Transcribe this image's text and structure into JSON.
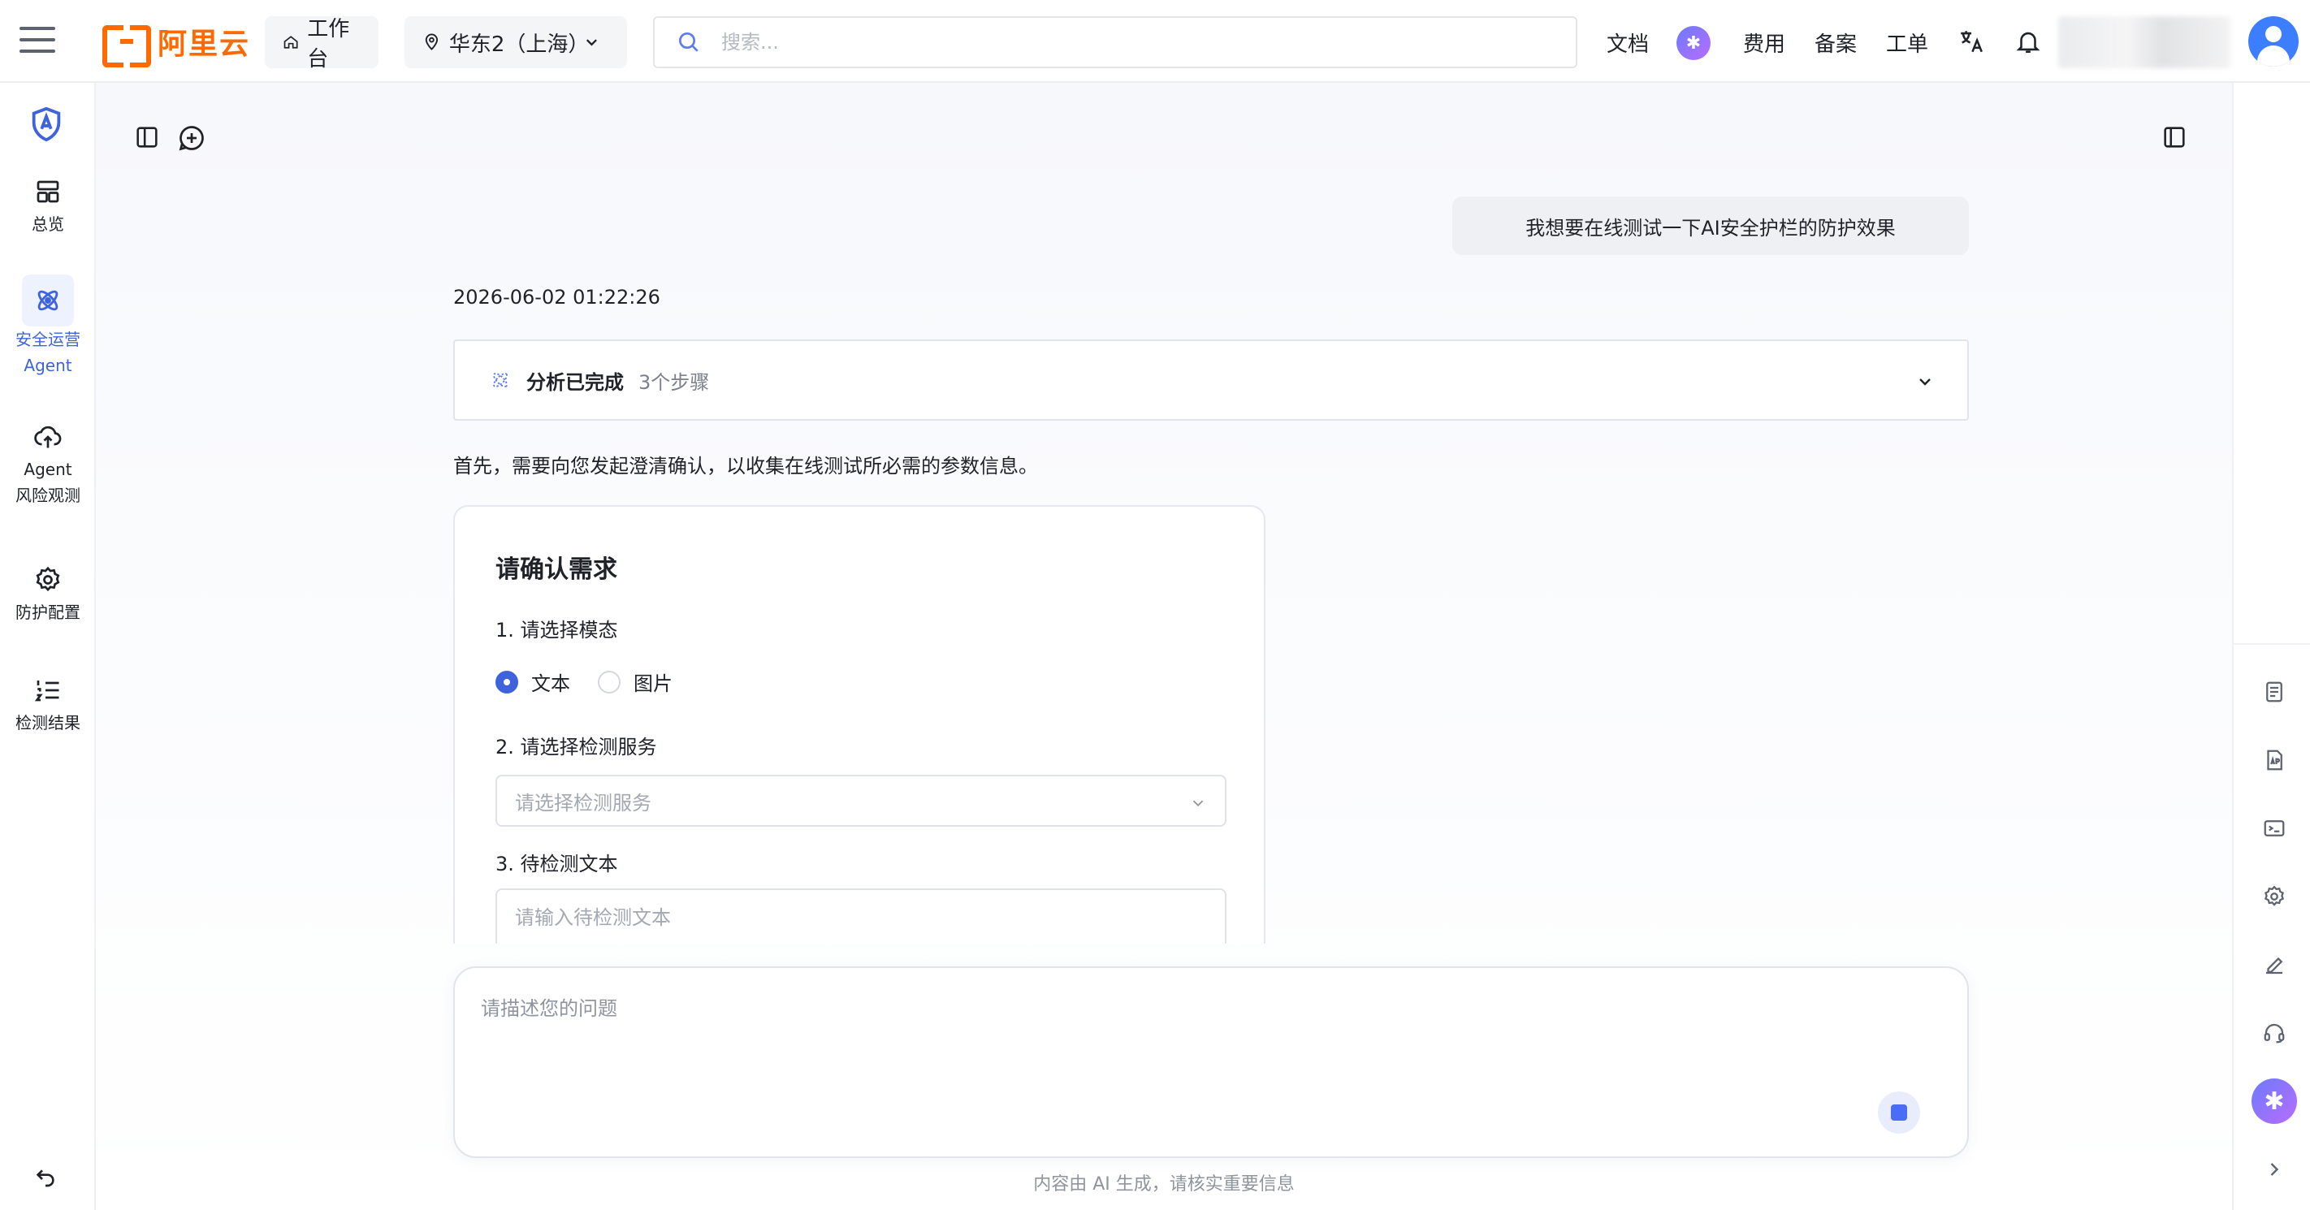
{
  "brand": {
    "logo_text": "阿里云",
    "color": "#ff6a00"
  },
  "topbar": {
    "workbench_label": "工作台",
    "region_label": "华东2（上海）",
    "search_placeholder": "搜索...",
    "links": {
      "docs": "文档",
      "fees": "费用",
      "filing": "备案",
      "ticket": "工单"
    },
    "icons": [
      "menu-icon",
      "home-icon",
      "location-icon",
      "search-icon",
      "ai-assistant-icon",
      "translate-icon",
      "bell-icon",
      "avatar"
    ]
  },
  "sidebar": {
    "items": [
      {
        "label": "总览",
        "icon": "dashboard-icon"
      },
      {
        "label": "安全运营",
        "label2": "Agent",
        "icon": "atom-icon",
        "active": true
      },
      {
        "label": "Agent",
        "label2": "风险观测",
        "icon": "cloud-upload-icon"
      },
      {
        "label": "防护配置",
        "icon": "gear-icon"
      },
      {
        "label": "检测结果",
        "icon": "list-ordered-icon"
      }
    ]
  },
  "chat": {
    "user_message": "我想要在线测试一下AI安全护栏的防护效果",
    "timestamp": "2026-06-02 01:22:26",
    "analysis": {
      "title": "分析已完成",
      "steps": "3个步骤"
    },
    "intro": "首先，需要向您发起澄清确认，以收集在线测试所必需的参数信息。",
    "card": {
      "title": "请确认需求",
      "q1": "1.  请选择模态",
      "options": [
        "文本",
        "图片"
      ],
      "selected": "文本",
      "q2": "2.  请选择检测服务",
      "select_placeholder": "请选择检测服务",
      "q3": "3.  待检测文本",
      "text_placeholder": "请输入待检测文本"
    },
    "composer_placeholder": "请描述您的问题",
    "disclaimer": "内容由 AI 生成，请核实重要信息"
  },
  "accent": "#3e63dd"
}
